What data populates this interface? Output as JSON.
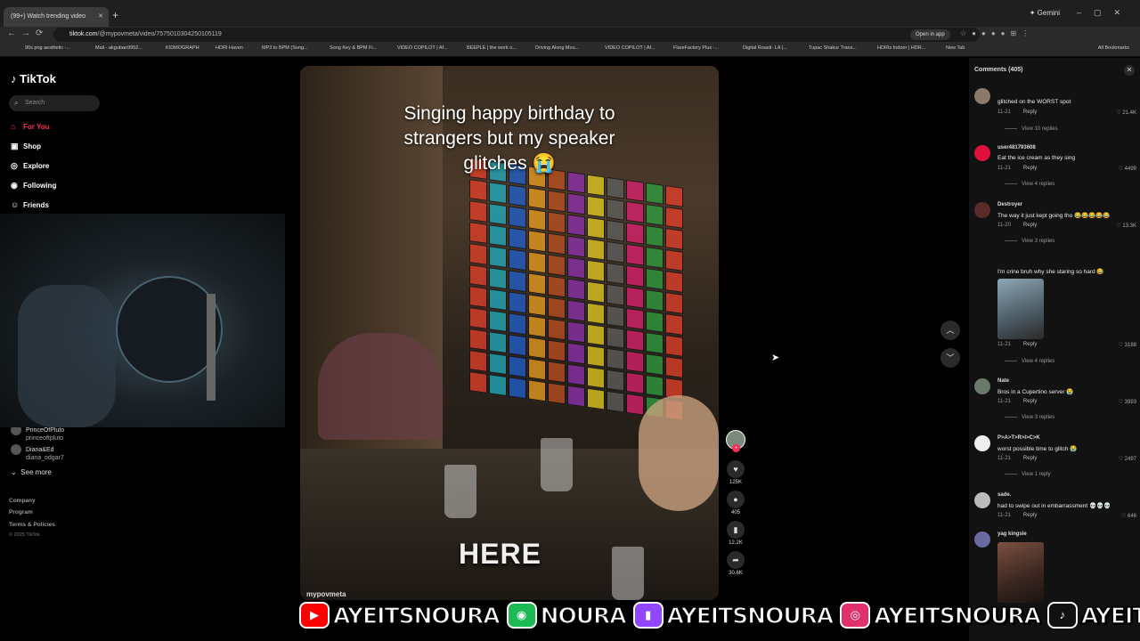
{
  "browser": {
    "tab_title": "(99+) Watch trending video",
    "new_tab": "+",
    "gemini_label": "Gemini",
    "address_domain": "tiktok.com",
    "address_path": "/@mypovmeta/video/7575010304250105119",
    "open_in_app": "Open in app",
    "bookmarks": [
      "90s png aesthetic -...",
      "Mail - akguban9952...",
      "KIDMOGRAPH",
      "HDRI Haven",
      "MP3 to BPM (Song...",
      "Song Key & BPM Fi...",
      "VIDEO COPILOT | Af...",
      "BEEPLE | the work o...",
      "Driving Along Mou...",
      "VIDEO COPILOT | Af...",
      "FlareFactory Plus -...",
      "Digital Roasti- LA |...",
      "Tupac Shakur Trans...",
      "HDRIs Indoor | HDR...",
      "New Tab"
    ],
    "all_bookmarks": "All Bookmarks"
  },
  "sidebar": {
    "logo": "TikTok",
    "search_placeholder": "Search",
    "nav": [
      {
        "label": "For You",
        "icon": "home-icon"
      },
      {
        "label": "Shop",
        "icon": "shop-icon"
      },
      {
        "label": "Explore",
        "icon": "compass-icon"
      },
      {
        "label": "Following",
        "icon": "following-icon"
      },
      {
        "label": "Friends",
        "icon": "friends-icon"
      }
    ],
    "following_accounts": [
      {
        "name": "PrinceOfPluto",
        "handle": "princeoftpluto"
      },
      {
        "name": "Diana&Ed",
        "handle": "diana_odgar7"
      }
    ],
    "see_more": "See more",
    "footer_links": [
      "Company",
      "Program",
      "Terms & Policies"
    ],
    "copyright": "© 2025 TikTok"
  },
  "video": {
    "caption": "Singing happy birthday to strangers but my speaker glitches 😭",
    "overlay_word": "HERE",
    "author": "mypovmeta",
    "likes": "125K",
    "comments": "405",
    "saves": "12.2K",
    "shares": "30.6K"
  },
  "comments_panel": {
    "title": "Comments (405)",
    "items": [
      {
        "user": "",
        "text": "glitched on the WORST spot",
        "date": "11-21",
        "likes": "21.4K",
        "replies": "View 10 replies"
      },
      {
        "user": "user481793608",
        "text": "Eat the ice cream as they sing",
        "date": "11-21",
        "likes": "4499",
        "replies": "View 4 replies"
      },
      {
        "user": "Destroyer",
        "text": "The way it just kept going tho 😂😂😂😂😂",
        "date": "11-20",
        "likes": "13.3K",
        "replies": "View 3 replies"
      },
      {
        "user": "",
        "text": "I'm crine bruh why she staring so hard 😂",
        "date": "11-21",
        "likes": "3188",
        "replies": "View 4 replies"
      },
      {
        "user": "Nate",
        "text": "Bros in a Cupertino server 😭",
        "date": "11-21",
        "likes": "3993",
        "replies": "View 3 replies"
      },
      {
        "user": "P>A>T>R>I>C>K",
        "text": "worst possible time to glitch 😭",
        "date": "11-21",
        "likes": "2497",
        "replies": "View 1 reply"
      },
      {
        "user": "sade.",
        "text": "had to swipe out in embarrassment 💀💀💀",
        "date": "11-21",
        "likes": "646",
        "replies": ""
      },
      {
        "user": "yag kingsle",
        "text": "",
        "date": "",
        "likes": "",
        "replies": ""
      }
    ],
    "reply_label": "Reply"
  },
  "stream_banner": {
    "items": [
      {
        "platform": "youtube",
        "handle": "AYEITSNOURA",
        "color": "#ff0000"
      },
      {
        "platform": "spotify",
        "handle": "NOURA",
        "color": "#1db954"
      },
      {
        "platform": "twitch",
        "handle": "AYEITSNOURA",
        "color": "#9146ff"
      },
      {
        "platform": "instagram",
        "handle": "AYEITSNOURA",
        "color": "#e1306c"
      },
      {
        "platform": "tiktok",
        "handle": "AYEITSNOURA",
        "color": "#111111"
      }
    ]
  },
  "colors": {
    "accent": "#fe2c55",
    "background": "#000000",
    "panel": "#121212"
  }
}
